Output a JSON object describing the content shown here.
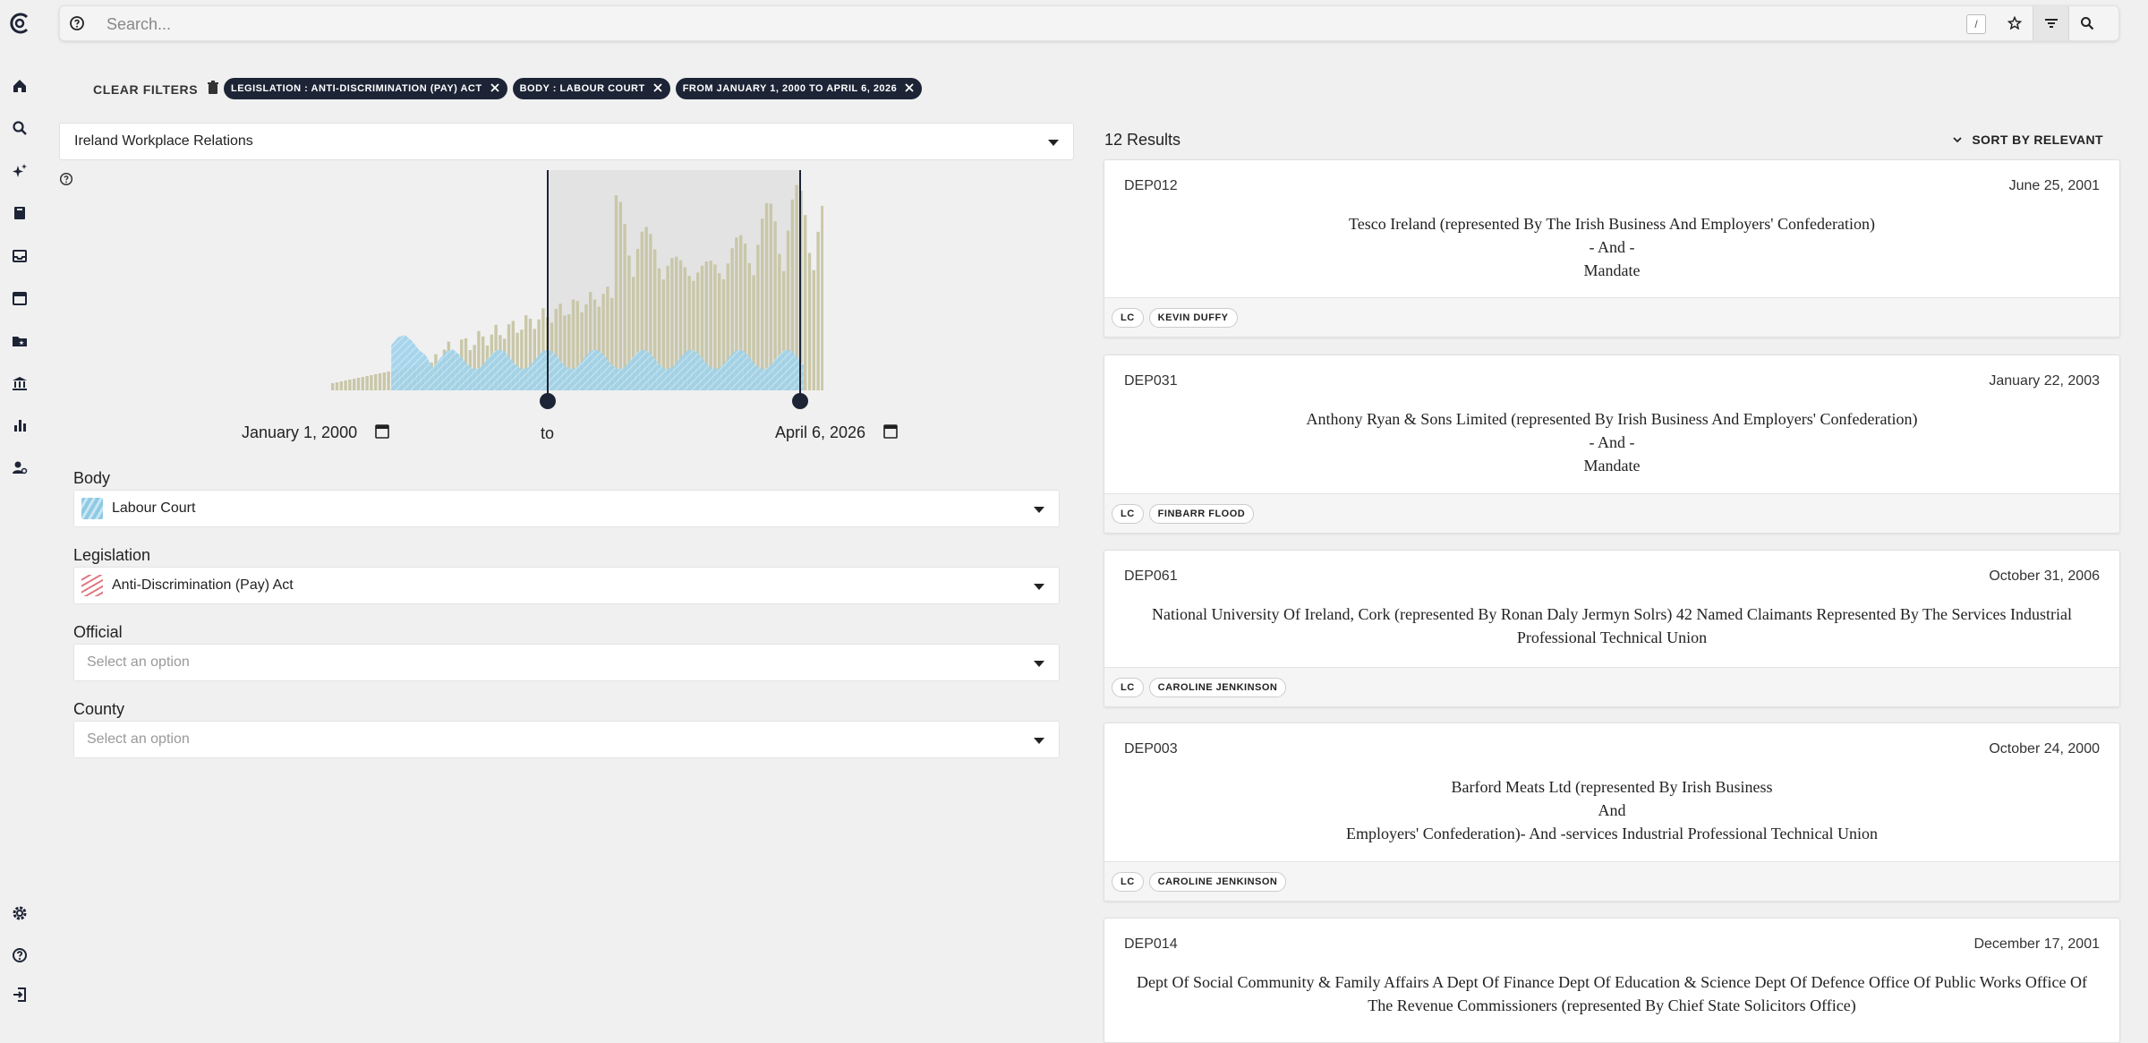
{
  "search": {
    "placeholder": "Search...",
    "shortcut": "/"
  },
  "filters": {
    "clear_label": "CLEAR FILTERS",
    "chips": [
      "LEGISLATION : ANTI-DISCRIMINATION (PAY) ACT",
      "BODY : LABOUR COURT",
      "FROM JANUARY 1, 2000 TO APRIL 6, 2026"
    ]
  },
  "dataset": {
    "value": "Ireland Workplace Relations"
  },
  "date_range": {
    "from": "January 1, 2000",
    "to_label": "to",
    "to": "April 6, 2026"
  },
  "fields": {
    "body": {
      "label": "Body",
      "value": "Labour Court"
    },
    "legislation": {
      "label": "Legislation",
      "value": "Anti-Discrimination (Pay) Act"
    },
    "official": {
      "label": "Official",
      "placeholder": "Select an option"
    },
    "county": {
      "label": "County",
      "placeholder": "Select an option"
    }
  },
  "results": {
    "count": "12 Results",
    "sort_label": "SORT BY RELEVANT",
    "items": [
      {
        "id": "DEP012",
        "date": "June 25, 2001",
        "title": [
          "Tesco Ireland (represented By The Irish Business And Employers' Confederation)",
          "- And -",
          "Mandate"
        ],
        "tags": [
          "LC",
          "KEVIN DUFFY"
        ]
      },
      {
        "id": "DEP031",
        "date": "January 22, 2003",
        "title": [
          "Anthony Ryan & Sons Limited (represented By Irish Business And Employers' Confederation)",
          "- And -",
          "Mandate"
        ],
        "tags": [
          "LC",
          "FINBARR FLOOD"
        ]
      },
      {
        "id": "DEP061",
        "date": "October 31, 2006",
        "title": [
          "National University Of Ireland, Cork (represented By Ronan Daly Jermyn Solrs) 42 Named Claimants Represented By The Services Industrial Professional Technical Union"
        ],
        "tags": [
          "LC",
          "CAROLINE JENKINSON"
        ]
      },
      {
        "id": "DEP003",
        "date": "October 24, 2000",
        "title": [
          "Barford Meats Ltd (represented By Irish Business",
          "And",
          "Employers' Confederation)- And -services Industrial Professional Technical Union"
        ],
        "tags": [
          "LC",
          "CAROLINE JENKINSON"
        ]
      },
      {
        "id": "DEP014",
        "date": "December 17, 2001",
        "title": [
          "Dept Of Social Community & Family Affairs A Dept Of Finance Dept Of Education & Science Dept Of Defence Office Of Public Works Office Of The Revenue Commissioners (represented By Chief State Solicitors Office)"
        ],
        "tags": []
      }
    ]
  },
  "colors": {
    "chip_bg": "#1d2436",
    "total_bars": "#c9c7a8",
    "filtered_bars": "#8fc9e4",
    "selection": "#e3e3e3"
  }
}
